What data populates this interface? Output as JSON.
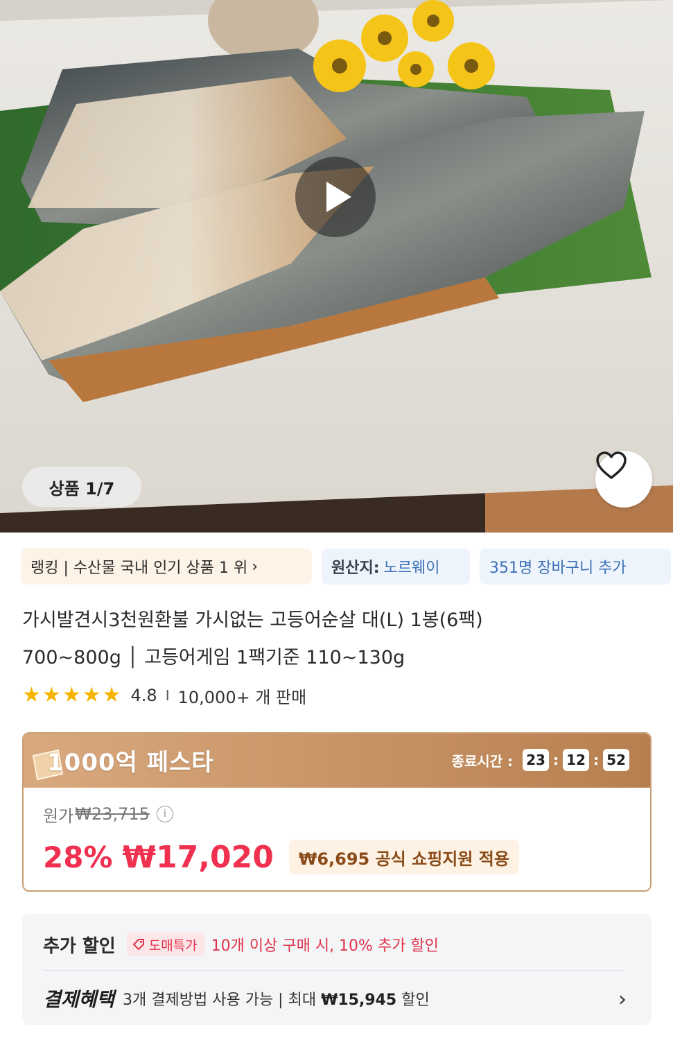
{
  "hero": {
    "counter_label": "상품 1/7"
  },
  "chips": {
    "ranking": "랭킹 | 수산물 국내 인기 상품 1 위",
    "origin_label": "원산지:",
    "origin_value": "노르웨이",
    "cart_count": "351명 장바구니 추가"
  },
  "product": {
    "title_line1": "가시발견시3천원환불 가시없는 고등어순살 대(L) 1봉(6팩)",
    "title_line2": "700~800g │ 고등어게임 1팩기준 110~130g",
    "rating": "4.8",
    "rating_separator": "I",
    "sold": "10,000+ 개 판매",
    "stars": 5
  },
  "festa": {
    "title": "1000억 페스타",
    "timer_label": "종료시간 :",
    "hours": "23",
    "minutes": "12",
    "seconds": "52",
    "orig_label": "원가",
    "orig_price": "₩23,715",
    "discount": "28%",
    "price": "₩17,020",
    "support": "₩6,695 공식 쇼핑지원 적용"
  },
  "extra": {
    "label": "추가 할인",
    "tag": "도매특가",
    "desc": "10개 이상 구매 시, 10% 추가 할인",
    "pay_label": "결제혜택",
    "pay_desc_pre": "3개 결제방법 사용 가능 | 최대 ",
    "pay_amount": "₩15,945",
    "pay_desc_post": " 할인"
  },
  "colors": {
    "accent_red": "#f0304f",
    "festa_brown": "#b77f4f",
    "link_blue": "#3b6fb8",
    "star": "#f6b400"
  },
  "icons": {
    "play": "play-icon",
    "heart": "heart-icon",
    "info": "info-icon",
    "chevron": "chevron-right-icon",
    "tag": "tag-icon",
    "star": "star-icon"
  }
}
